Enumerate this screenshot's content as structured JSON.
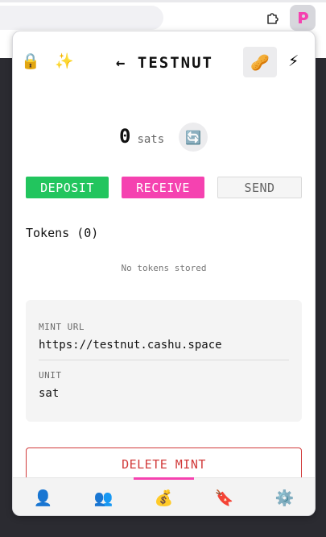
{
  "popup": {
    "header": {
      "lock_icon": "🔒",
      "sparkle_icon": "✨",
      "title": "← TESTNUT",
      "peanut_icon": "🥜",
      "lightning_icon": "⚡"
    },
    "balance": {
      "value": "0",
      "unit": "sats",
      "refresh_icon": "🔄"
    },
    "actions": {
      "deposit": "DEPOSIT",
      "receive": "RECEIVE",
      "send": "SEND"
    },
    "tokens": {
      "heading": "Tokens (0)",
      "empty_text": "No tokens stored"
    },
    "mint_info": {
      "url_label": "MINT URL",
      "url_value": "https://testnut.cashu.space",
      "unit_label": "UNIT",
      "unit_value": "sat"
    },
    "delete_label": "DELETE MINT",
    "nav": [
      {
        "name": "profile",
        "icon": "👤"
      },
      {
        "name": "contacts",
        "icon": "👥"
      },
      {
        "name": "wallet",
        "icon": "💰",
        "active": true
      },
      {
        "name": "bookmarks",
        "icon": "🔖"
      },
      {
        "name": "settings",
        "icon": "⚙️"
      }
    ]
  },
  "colors": {
    "deposit": "#22c55e",
    "receive": "#f542b0",
    "delete": "#d13a3a",
    "active_indicator": "#f542b0"
  }
}
